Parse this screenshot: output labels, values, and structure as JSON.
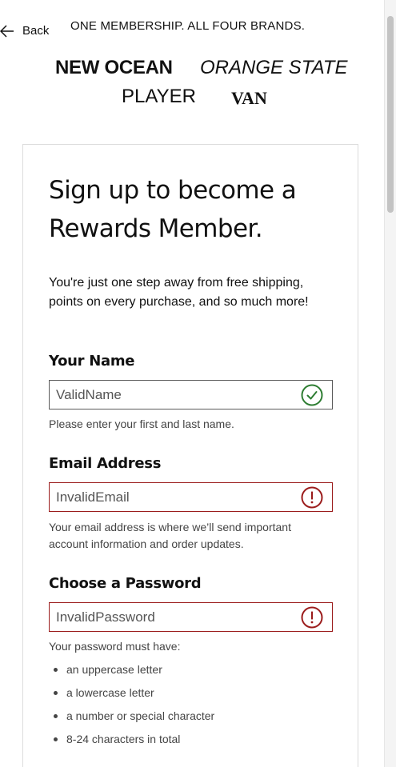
{
  "header": {
    "back_label": "Back",
    "promo": "ONE MEMBERSHIP. ALL FOUR BRANDS.",
    "brands": [
      "NEW OCEAN",
      "ORANGE STATE",
      "PLAYER",
      "VAN"
    ]
  },
  "form": {
    "title": "Sign up to become a Rewards Member.",
    "intro": "You're just one step away from free shipping, points on every purchase, and so much more!",
    "name": {
      "label": "Your Name",
      "value": "ValidName",
      "status": "valid",
      "helper": "Please enter your first and last name."
    },
    "email": {
      "label": "Email Address",
      "value": "InvalidEmail",
      "status": "invalid",
      "helper": "Your email address is where we’ll send important account information and order updates."
    },
    "password": {
      "label": "Choose a Password",
      "value": "InvalidPassword",
      "status": "invalid",
      "helper": "Your password must have:",
      "rules": [
        "an uppercase letter",
        "a lowercase letter",
        "a number or special character",
        "8-24 characters in total"
      ]
    }
  },
  "colors": {
    "valid": "#2e7d32",
    "invalid": "#9b1c1c",
    "border": "#5a5a5a"
  },
  "icons": {
    "back": "arrow-left-icon",
    "valid": "check-circle-icon",
    "invalid": "exclamation-circle-icon"
  }
}
